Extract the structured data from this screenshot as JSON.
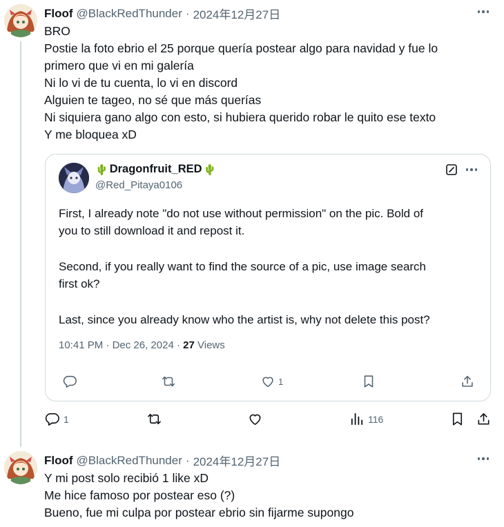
{
  "tweet1": {
    "name": "Floof",
    "handle": "@BlackRedThunder",
    "separator": "·",
    "date": "2024年12月27日",
    "lines": [
      "BRO",
      "Postie la foto ebrio el 25 porque quería postear algo para navidad y fue lo",
      "primero que vi en mi galería",
      "Ni lo vi de tu cuenta, lo vi en discord",
      "Alguien te tageo, no sé que más querías",
      "Ni siquiera gano algo con esto, si hubiera querido robar le quito ese texto",
      "Y me bloquea xD"
    ],
    "actions": {
      "reply_count": "1",
      "repost_count": "",
      "like_count": "",
      "views_count": "116"
    }
  },
  "quote": {
    "name": "Dragonfruit_RED",
    "name_emoji_left": "🌵",
    "name_emoji_right": "🌵",
    "handle": "@Red_Pitaya0106",
    "paragraphs": [
      [
        "First, I already note \"do not use without permission\" on the pic. Bold of",
        "you to still download it and repost it."
      ],
      [
        "Second, if you really want to find the source of a pic, use image search",
        "first ok?"
      ],
      [
        "Last, since you already know who the artist is, why not delete this post?"
      ]
    ],
    "time": "10:41 PM",
    "date": "Dec 26, 2024",
    "separator": "·",
    "views_count": "27",
    "views_label": "Views",
    "actions": {
      "reply_count": "",
      "repost_count": "",
      "like_count": "1"
    }
  },
  "tweet2": {
    "name": "Floof",
    "handle": "@BlackRedThunder",
    "separator": "·",
    "date": "2024年12月27日",
    "lines": [
      "Y mi post solo recibió 1 like xD",
      "Me hice famoso por postear eso (?)",
      "Bueno, fue mi culpa por postear ebrio sin fijarme supongo"
    ]
  },
  "colors": {
    "text": "#0f1419",
    "muted": "#536471",
    "border": "#cfd9de"
  },
  "icons": [
    "more-icon",
    "reply-icon",
    "repost-icon",
    "like-icon",
    "views-icon",
    "bookmark-icon",
    "share-icon",
    "grok-icon",
    "cactus-icon"
  ]
}
